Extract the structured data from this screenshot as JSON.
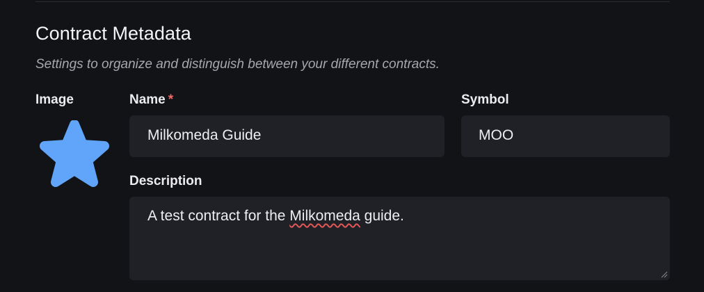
{
  "section": {
    "title": "Contract Metadata",
    "subtitle": "Settings to organize and distinguish between your different contracts."
  },
  "image": {
    "label": "Image",
    "icon": "star-icon",
    "color": "#60a5fa"
  },
  "name": {
    "label": "Name",
    "required_marker": "*",
    "value": "Milkomeda Guide"
  },
  "symbol": {
    "label": "Symbol",
    "value": "MOO"
  },
  "description": {
    "label": "Description",
    "value_before": "A test contract for the ",
    "value_misspelled": "Milkomeda",
    "value_after": " guide."
  },
  "colors": {
    "background": "#121316",
    "input_background": "#202126",
    "required": "#ef6b6b",
    "spellcheck": "#e25757"
  }
}
